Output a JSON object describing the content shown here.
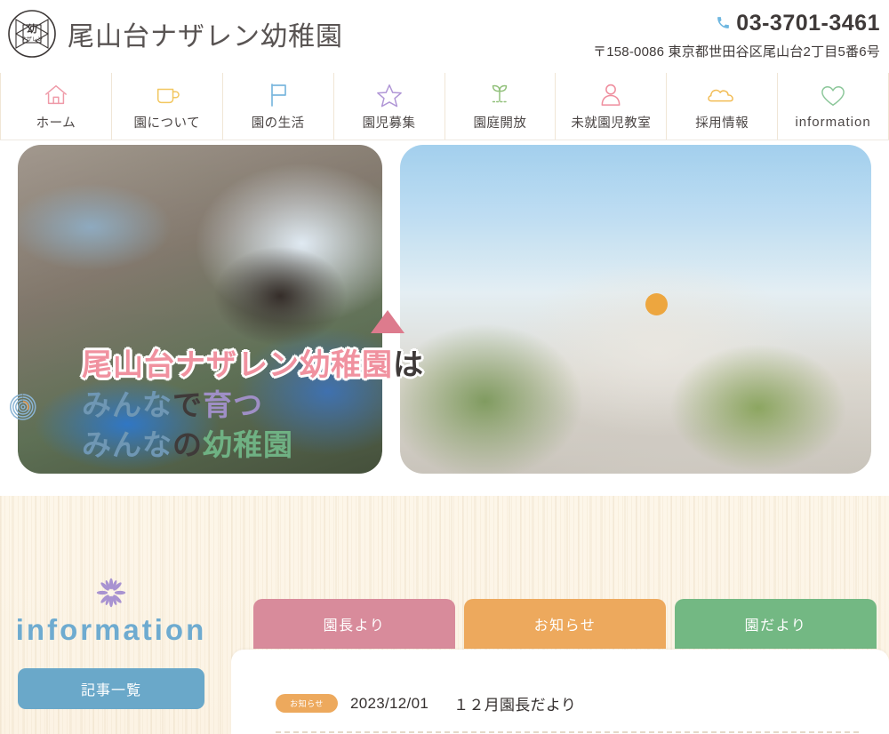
{
  "header": {
    "logo_alt": "尾山台ナザレン幼稚園 ロゴ",
    "logo_kanji": "幼",
    "logo_katakana": "ナザレン",
    "site_title": "尾山台ナザレン幼稚園",
    "phone_icon": "phone-icon",
    "phone": "03-3701-3461",
    "address": "〒158-0086 東京都世田谷区尾山台2丁目5番6号"
  },
  "nav": {
    "items": [
      {
        "label": "ホーム",
        "icon": "house-icon",
        "color": "#ef9aa8"
      },
      {
        "label": "園について",
        "icon": "mug-icon",
        "color": "#f2c760"
      },
      {
        "label": "園の生活",
        "icon": "flag-icon",
        "color": "#7bb7de"
      },
      {
        "label": "園児募集",
        "icon": "star-icon",
        "color": "#b096d6"
      },
      {
        "label": "園庭開放",
        "icon": "sprout-icon",
        "color": "#91c07a"
      },
      {
        "label": "未就園児教室",
        "icon": "person-icon",
        "color": "#ef8e9e"
      },
      {
        "label": "採用情報",
        "icon": "cloud-icon",
        "color": "#f2bc55"
      },
      {
        "label": "information",
        "icon": "heart-icon",
        "color": "#8cc79a"
      }
    ]
  },
  "hero": {
    "photo_left_alt": "お弁当を食べる前に手を合わせる園児",
    "photo_right_alt": "尾山台ナザレン幼稚園の園舎外観",
    "headline_line1_a": "尾山台ナザレン幼稚園",
    "headline_line1_b": "は",
    "headline_line2_a": "みんな",
    "headline_line2_b": "で",
    "headline_line2_c": "育つ",
    "headline_line3_a": "みんな",
    "headline_line3_b": "の",
    "headline_line3_c": "幼稚園",
    "decorations": [
      {
        "name": "spiral-decoration",
        "color": "#7fa8c9"
      },
      {
        "name": "triangle-pink-decoration",
        "color": "#e2798c"
      },
      {
        "name": "circle-orange-decoration",
        "color": "#eda63f"
      },
      {
        "name": "circle-yellow-decoration",
        "color": "#f2d23f"
      },
      {
        "name": "card-orange-decoration",
        "color": "#eda95d"
      },
      {
        "name": "triangle-green-decoration",
        "color": "#5fa96a"
      },
      {
        "name": "rect-purple-decoration",
        "color": "#c8a8dd"
      }
    ]
  },
  "information": {
    "flower_icon": "flower-asterisk-icon",
    "title": "information",
    "button_label": "記事一覧",
    "tabs": [
      {
        "label": "園長より",
        "color": "#d88b9b"
      },
      {
        "label": "お知らせ",
        "color": "#eda95d"
      },
      {
        "label": "園だより",
        "color": "#73b883"
      }
    ],
    "news": [
      {
        "badge": "お知らせ",
        "badge_color": "#eda95d",
        "date": "2023/12/01",
        "title": "１２月園長だより"
      }
    ]
  },
  "colors": {
    "accent_blue": "#6eabd0",
    "accent_pink": "#f0919f",
    "accent_green": "#6fb183",
    "accent_purple": "#9f8fc6",
    "accent_orange": "#eda95d",
    "bg_cream": "#fdf6e9",
    "text_dark": "#3f3a39"
  }
}
